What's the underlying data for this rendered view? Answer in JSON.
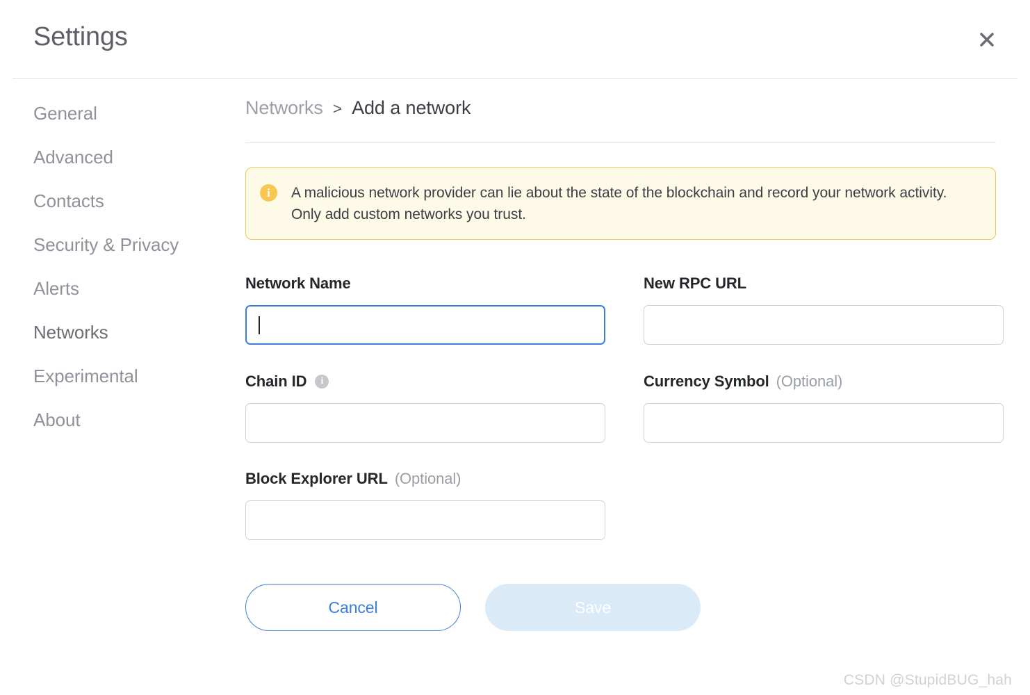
{
  "window": {
    "title": "Settings",
    "close_icon": "close-icon"
  },
  "sidebar": {
    "items": [
      {
        "label": "General"
      },
      {
        "label": "Advanced"
      },
      {
        "label": "Contacts"
      },
      {
        "label": "Security & Privacy"
      },
      {
        "label": "Alerts"
      },
      {
        "label": "Networks"
      },
      {
        "label": "Experimental"
      },
      {
        "label": "About"
      }
    ]
  },
  "breadcrumb": {
    "parent": "Networks",
    "separator": ">",
    "current": "Add a network"
  },
  "banner": {
    "icon": "info-icon",
    "text": "A malicious network provider can lie about the state of the blockchain and record your network activity. Only add custom networks you trust.",
    "background_color": "#fdfbe8",
    "border_color": "#f2c94c",
    "icon_color": "#f8c753"
  },
  "form": {
    "fields": {
      "network_name": {
        "label": "Network Name",
        "value": "",
        "placeholder": "",
        "focused": true
      },
      "new_rpc_url": {
        "label": "New RPC URL",
        "value": "",
        "placeholder": "",
        "focused": false
      },
      "chain_id": {
        "label": "Chain ID",
        "info_icon": "info-icon",
        "value": "",
        "placeholder": "",
        "focused": false
      },
      "currency_symbol": {
        "label": "Currency Symbol",
        "optional": "(Optional)",
        "value": "",
        "placeholder": "",
        "focused": false
      },
      "block_explorer_url": {
        "label": "Block Explorer URL",
        "optional": "(Optional)",
        "value": "",
        "placeholder": "",
        "focused": false
      }
    }
  },
  "actions": {
    "cancel_label": "Cancel",
    "save_label": "Save",
    "accent_color": "#3b7ddd",
    "save_disabled_color": "#dbeaf7"
  },
  "watermark": {
    "text": "CSDN @StupidBUG_hah"
  }
}
